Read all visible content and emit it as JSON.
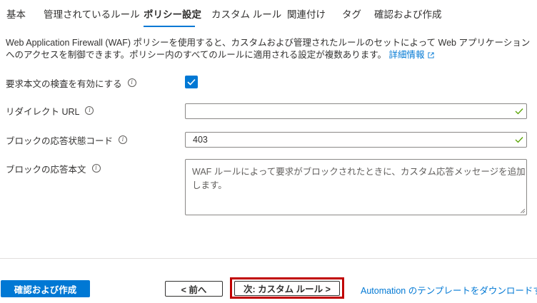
{
  "tabs": [
    {
      "label": "基本"
    },
    {
      "label": "管理されているルール"
    },
    {
      "label": "ポリシー設定",
      "active": true
    },
    {
      "label": "カスタム ルール"
    },
    {
      "label": "関連付け"
    },
    {
      "label": "タグ"
    },
    {
      "label": "確認および作成"
    }
  ],
  "description": {
    "text": "Web Application Firewall (WAF) ポリシーを使用すると、カスタムおよび管理されたルールのセットによって Web アプリケーションへのアクセスを制御できます。ポリシー内のすべてのルールに適用される設定が複数あります。",
    "link": "詳細情報"
  },
  "fields": {
    "inspect_body": {
      "label": "要求本文の検査を有効にする",
      "checked": true
    },
    "redirect_url": {
      "label": "リダイレクト URL",
      "value": ""
    },
    "block_status": {
      "label": "ブロックの応答状態コード",
      "value": "403"
    },
    "block_body": {
      "label": "ブロックの応答本文",
      "placeholder": "WAF ルールによって要求がブロックされたときに、カスタム応答メッセージを追加します。"
    }
  },
  "footer": {
    "review_create": "確認および作成",
    "prev": "< 前へ",
    "next": "次: カスタム ルール >",
    "automation_link": "Automation のテンプレートをダウンロードする"
  },
  "colors": {
    "accent": "#0078d4",
    "valid": "#57a300",
    "highlight": "#c00000"
  }
}
